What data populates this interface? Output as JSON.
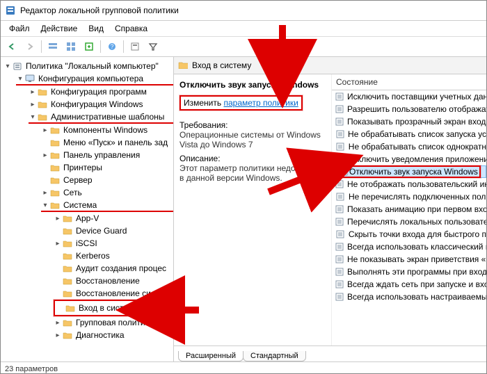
{
  "window": {
    "title": "Редактор локальной групповой политики"
  },
  "menu": {
    "file": "Файл",
    "action": "Действие",
    "view": "Вид",
    "help": "Справка"
  },
  "tree": {
    "root": "Политика \"Локальный компьютер\"",
    "computer_config": "Конфигурация компьютера",
    "software": "Конфигурация программ",
    "windows_cfg": "Конфигурация Windows",
    "admin_templates": "Административные шаблоны",
    "windows_components": "Компоненты Windows",
    "start_menu": "Меню «Пуск» и панель зад",
    "control_panel": "Панель управления",
    "printers": "Принтеры",
    "server": "Сервер",
    "network": "Сеть",
    "system": "Система",
    "appv": "App-V",
    "device_guard": "Device Guard",
    "iscsi": "iSCSI",
    "kerberos": "Kerberos",
    "audit": "Аудит создания процес",
    "recovery": "Восстановление",
    "recovery_system": "Восстановление систем",
    "logon": "Вход в систему",
    "group_policy": "Групповая политика",
    "diagnostics": "Диагностика"
  },
  "right": {
    "header": "Вход в систему",
    "policy_title": "Отключить звук запуска Windows",
    "edit_prefix": "Изменить ",
    "edit_link": "параметр политики",
    "req_label": "Требования:",
    "req_text": "Операционные системы от Windows Vista до Windows 7",
    "desc_label": "Описание:",
    "desc_text": "Этот параметр политики недоступен в данной версии Windows.",
    "col_state": "Состояние",
    "items": [
      "Исключить поставщики учетных дан",
      "Разрешить пользователю отображат",
      "Показывать прозрачный экран входа",
      "Не обрабатывать список запуска ус",
      "Не обрабатывать список однократн",
      "Отключить уведомления приложени",
      "Отключить звук запуска Windows",
      "Не отображать пользовательский ин",
      "Не перечислять подключенных пол",
      "Показать анимацию при первом вхо",
      "Перечислять локальных пользовате",
      "Скрыть точки входа для быстрого п",
      "Всегда использовать классический в",
      "Не показывать экран приветствия «П",
      "Выполнять эти программы при вход",
      "Всегда ждать сеть при запуске и вхо",
      "Всегда использовать настраиваемый"
    ],
    "selected_index": 6
  },
  "tabs": {
    "extended": "Расширенный",
    "standard": "Стандартный"
  },
  "status": {
    "text": "23 параметров"
  }
}
